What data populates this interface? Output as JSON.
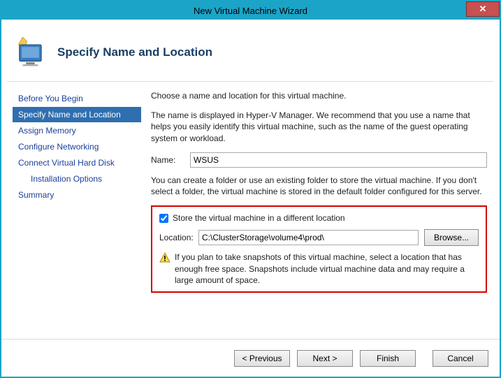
{
  "window": {
    "title": "New Virtual Machine Wizard",
    "close_glyph": "✕"
  },
  "header": {
    "title": "Specify Name and Location"
  },
  "sidebar": {
    "steps": [
      "Before You Begin",
      "Specify Name and Location",
      "Assign Memory",
      "Configure Networking",
      "Connect Virtual Hard Disk",
      "Installation Options",
      "Summary"
    ]
  },
  "content": {
    "intro": "Choose a name and location for this virtual machine.",
    "name_desc": "The name is displayed in Hyper-V Manager. We recommend that you use a name that helps you easily identify this virtual machine, such as the name of the guest operating system or workload.",
    "name_label": "Name:",
    "name_value": "WSUS",
    "loc_desc": "You can create a folder or use an existing folder to store the virtual machine. If you don't select a folder, the virtual machine is stored in the default folder configured for this server.",
    "store_checkbox_label": "Store the virtual machine in a different location",
    "store_checked": true,
    "location_label": "Location:",
    "location_value": "C:\\ClusterStorage\\volume4\\prod\\",
    "browse_label": "Browse...",
    "warning_text": "If you plan to take snapshots of this virtual machine, select a location that has enough free space. Snapshots include virtual machine data and may require a large amount of space."
  },
  "footer": {
    "previous": "< Previous",
    "next": "Next >",
    "finish": "Finish",
    "cancel": "Cancel"
  }
}
